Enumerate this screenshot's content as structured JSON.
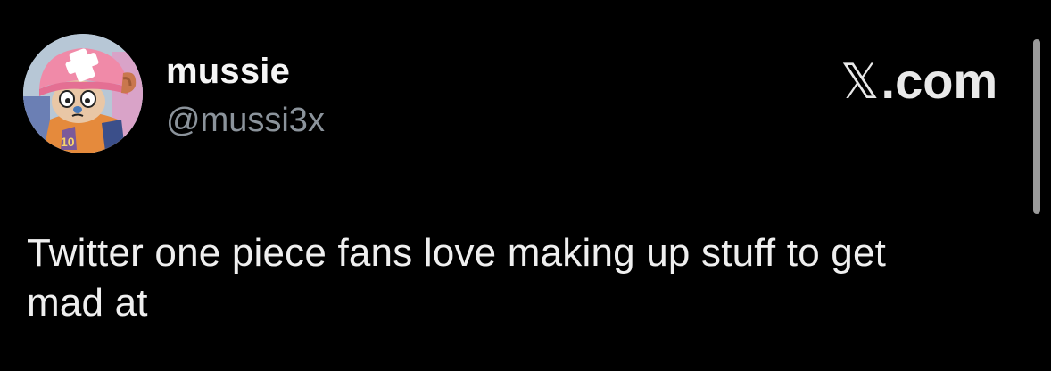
{
  "tweet": {
    "author": {
      "display_name": "mussie",
      "handle": "@mussi3x",
      "avatar_icon": "chopper-avatar-icon"
    },
    "brand": {
      "x_mark": "𝕏",
      "suffix": ".com"
    },
    "text_line1": "Twitter one piece fans love making up stuff to get",
    "text_line2": "mad at"
  },
  "colors": {
    "background": "#000000",
    "text": "#efefef",
    "handle": "#8b939b",
    "avatar_hat": "#f08aa8"
  }
}
